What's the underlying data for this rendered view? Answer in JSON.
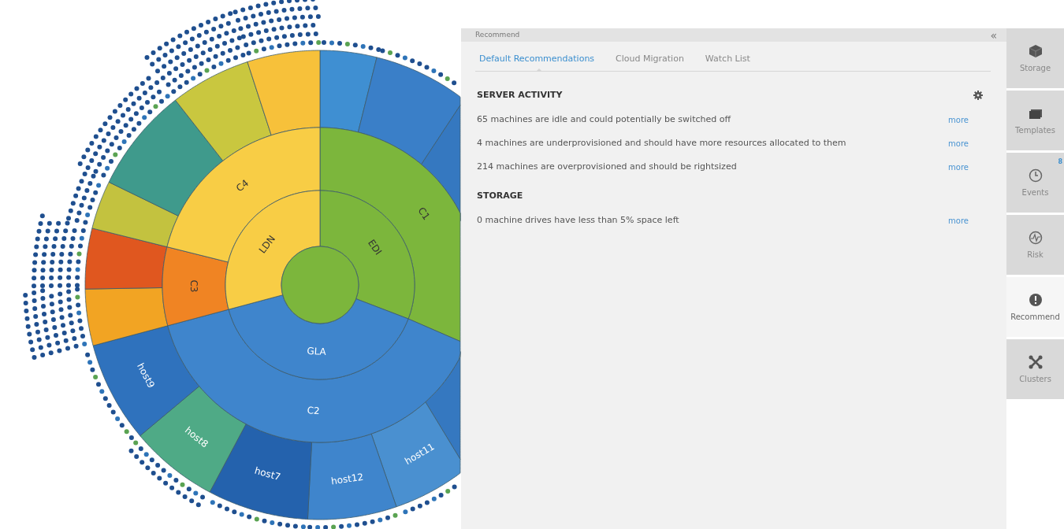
{
  "sunburst": {
    "center": {
      "color": "#7cb63c"
    },
    "regions": [
      {
        "label": "EDI",
        "color": "#7cb63c"
      },
      {
        "label": "GLA",
        "color": "#3f85cc"
      },
      {
        "label": "LDN",
        "color": "#f8cd45"
      }
    ],
    "clusters": [
      {
        "label": "C1",
        "color": "#7cb63c"
      },
      {
        "label": "C2",
        "color": "#3f85cc"
      },
      {
        "label": "C3",
        "color": "#f08423"
      },
      {
        "label": "C4",
        "color": "#f8cd45"
      }
    ],
    "hosts": [
      {
        "color": "#3f8fd2"
      },
      {
        "color": "#3a7fc8"
      },
      {
        "color": "#3578c0"
      },
      {
        "color": "#3578c0"
      },
      {
        "label": "host11",
        "color": "#4a90d0"
      },
      {
        "label": "host12",
        "color": "#3f85cc"
      },
      {
        "label": "host7",
        "color": "#2462ad"
      },
      {
        "label": "host8",
        "color": "#4faa86"
      },
      {
        "label": "host9",
        "color": "#2f72bd"
      },
      {
        "color": "#f2a423"
      },
      {
        "color": "#e0571f"
      },
      {
        "color": "#c3c23f"
      },
      {
        "color": "#3f9a8c"
      },
      {
        "color": "#c9c73f"
      },
      {
        "color": "#f7c13a"
      }
    ]
  },
  "panel": {
    "title": "Recommend",
    "collapse_icon": "«",
    "tabs": [
      {
        "label": "Default Recommendations",
        "selected": true
      },
      {
        "label": "Cloud Migration",
        "selected": false
      },
      {
        "label": "Watch List",
        "selected": false
      }
    ],
    "sections": [
      {
        "heading": "SERVER ACTIVITY",
        "settings": true,
        "items": [
          {
            "text": "65 machines are idle and could potentially be switched off",
            "link": "more"
          },
          {
            "text": "4 machines are underprovisioned and should have more resources allocated to them",
            "link": "more"
          },
          {
            "text": "214 machines are overprovisioned and should be rightsized",
            "link": "more"
          }
        ]
      },
      {
        "heading": "STORAGE",
        "items": [
          {
            "text": "0 machine drives have less than 5% space left",
            "link": "more"
          }
        ]
      }
    ]
  },
  "sidebar": {
    "items": [
      {
        "kind": "storage",
        "label": "Storage",
        "selected": false
      },
      {
        "kind": "templates",
        "label": "Templates",
        "selected": false
      },
      {
        "kind": "events",
        "label": "Events",
        "selected": false,
        "badge": "8"
      },
      {
        "kind": "risk",
        "label": "Risk",
        "selected": false
      },
      {
        "kind": "recommend",
        "label": "Recommend",
        "selected": true
      },
      {
        "kind": "clusters",
        "label": "Clusters",
        "selected": false
      }
    ]
  }
}
